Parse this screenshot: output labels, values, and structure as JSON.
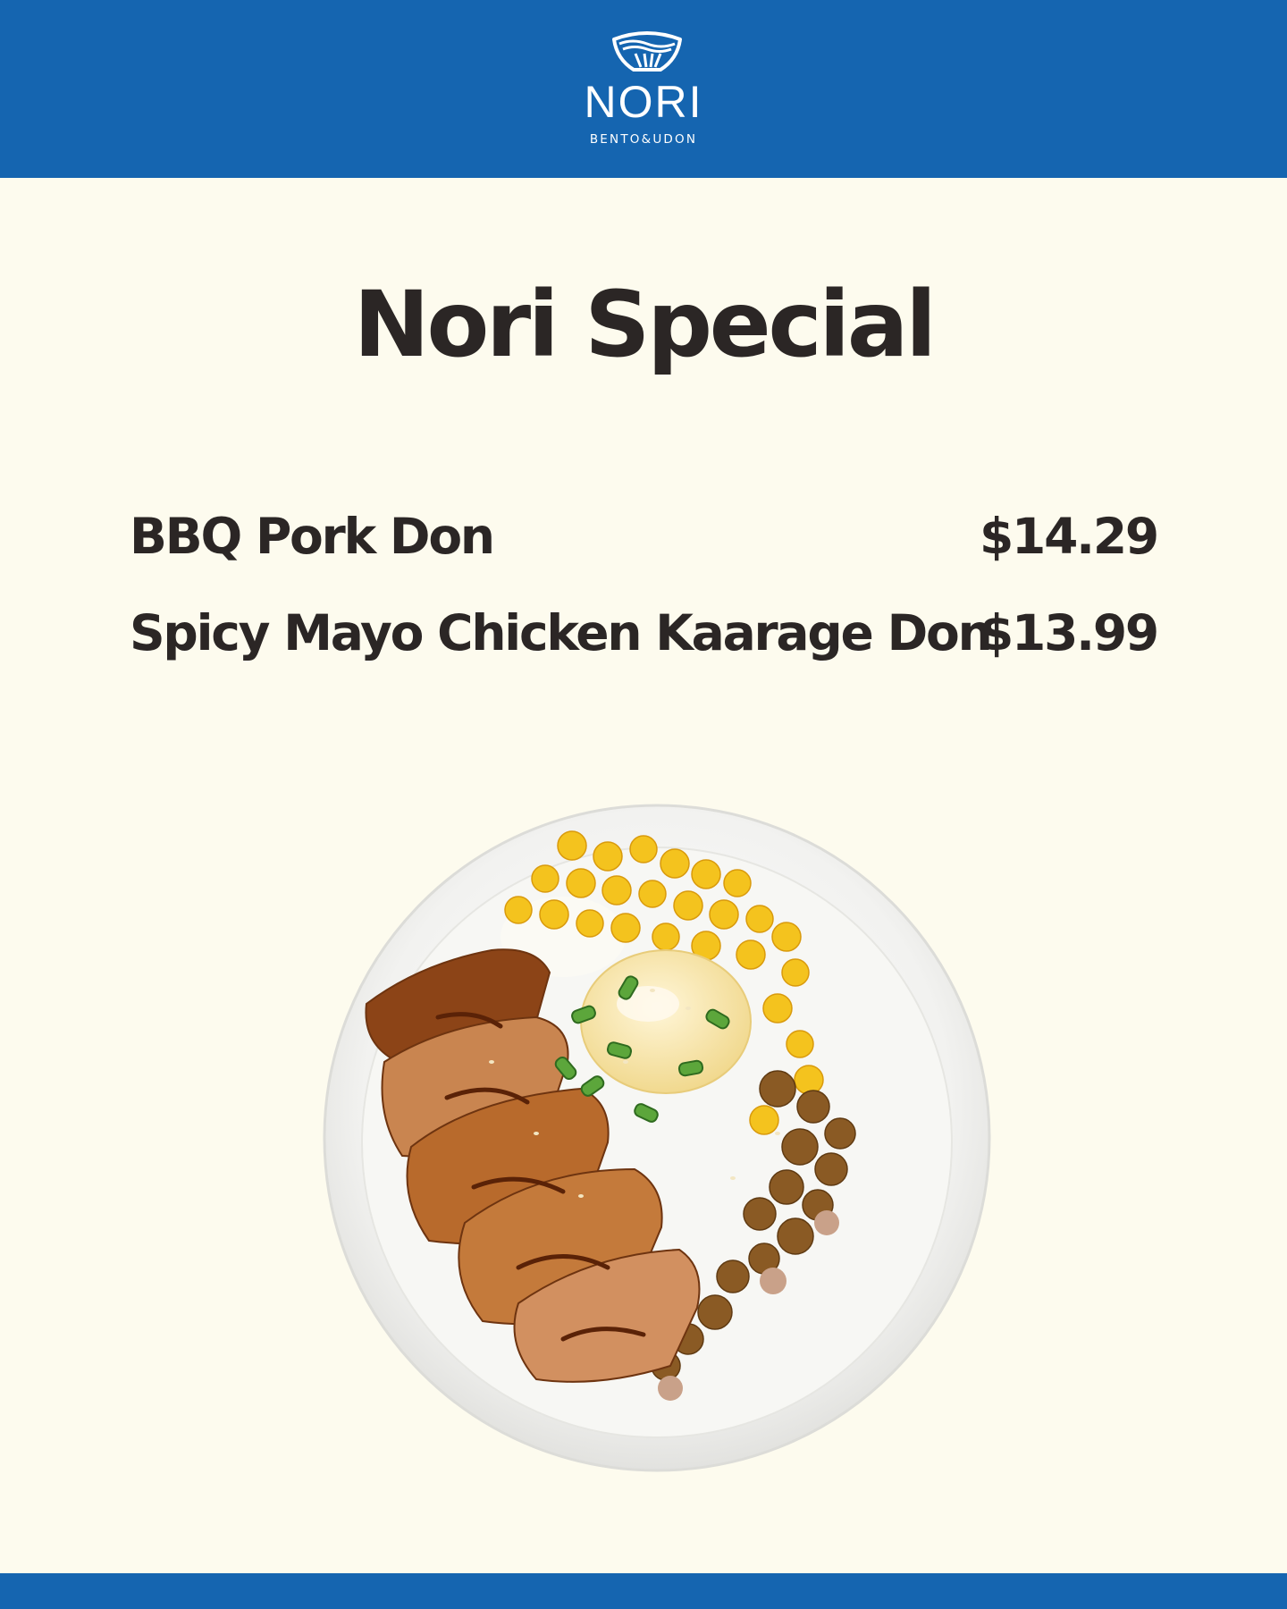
{
  "brand": {
    "name": "NORI",
    "tagline": "BENTO&UDON",
    "emblem_icon": "rice-bowl-wave-icon",
    "colors": {
      "primary_blue": "#1565b0",
      "background": "#fdfbee",
      "text": "#2b2625"
    }
  },
  "title": "Nori Special",
  "menu": {
    "items": [
      {
        "name": "BBQ Pork Don",
        "price": "$14.29"
      },
      {
        "name": "Spicy Mayo Chicken Kaarage Don",
        "price": "$13.99"
      }
    ]
  },
  "photo": {
    "icon": "rice-bowl-photo"
  }
}
